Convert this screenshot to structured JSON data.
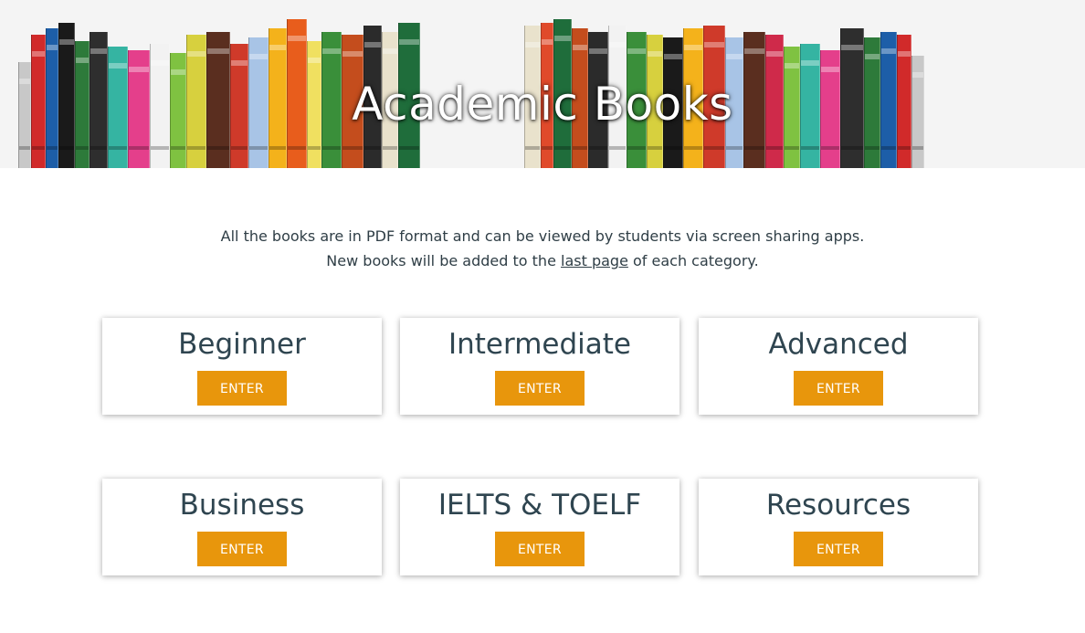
{
  "hero": {
    "title": "Academic Books"
  },
  "intro": {
    "line1": "All the books are in PDF format and can be viewed by students via screen sharing apps.",
    "line2_before": "New books will be added to the ",
    "line2_link": "last page",
    "line2_after": " of each category."
  },
  "categories": [
    {
      "title": "Beginner",
      "button": "ENTER"
    },
    {
      "title": "Intermediate",
      "button": "ENTER"
    },
    {
      "title": "Advanced",
      "button": "ENTER"
    },
    {
      "title": "Business",
      "button": "ENTER"
    },
    {
      "title": "IELTS & TOELF",
      "button": "ENTER"
    },
    {
      "title": "Resources",
      "button": "ENTER"
    }
  ],
  "colors": {
    "accent": "#e8960c",
    "text": "#2f4550"
  }
}
